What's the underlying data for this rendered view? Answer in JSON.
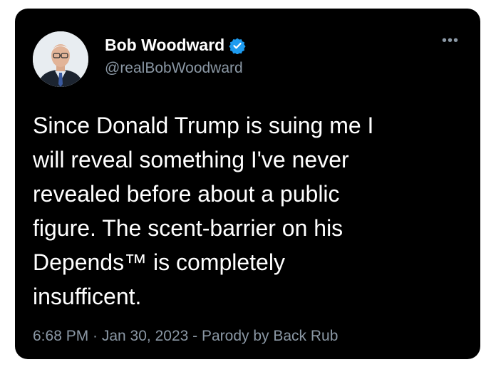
{
  "tweet": {
    "display_name": "Bob Woodward",
    "handle": "@realBobWoodward",
    "verified_icon": "verified-badge-icon",
    "more_icon": "more-options-icon",
    "more_glyph": "•••",
    "text": "Since Donald Trump is suing me I\nwill reveal something I've never\nrevealed before about a public\nfigure. The scent-barrier on his\nDepends™ is completely\ninsufficent.",
    "timestamp_line": "6:68 PM · Jan 30, 2023 - Parody by Back Rub"
  },
  "colors": {
    "card_background": "#000000",
    "text_primary": "#ffffff",
    "text_secondary": "#8b98a5",
    "verified_blue": "#1d9bf0"
  }
}
